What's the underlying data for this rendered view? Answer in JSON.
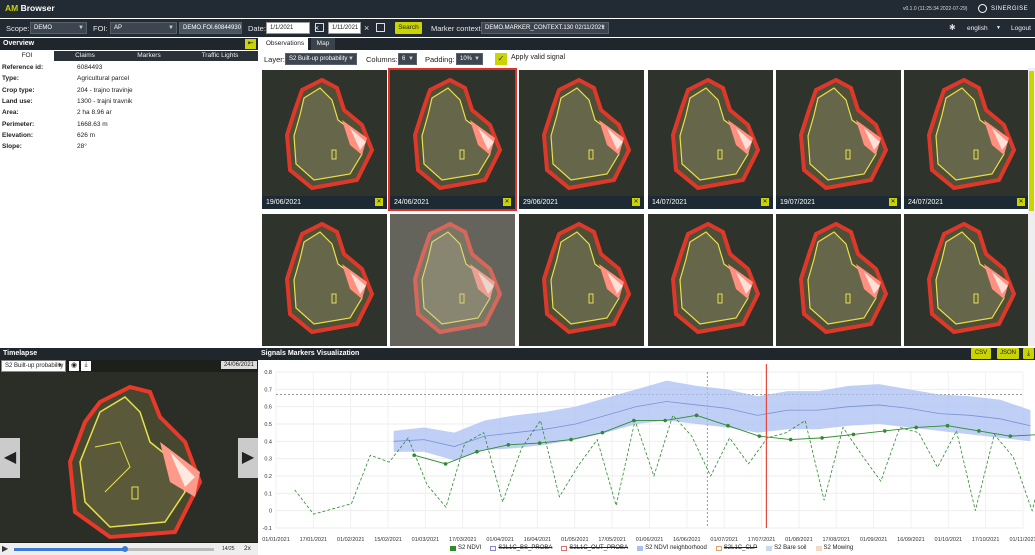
{
  "app": {
    "logo_am": "AM",
    "logo_rest": "Browser",
    "version": "v0.1.0 (11:25:34 2022-07-29)",
    "brand": "SINERGISE",
    "language": "english",
    "logout": "Logout"
  },
  "controls": {
    "scope_label": "Scope:",
    "scope_value": "DEMO",
    "foi_label": "FOI:",
    "foi_value": "AP",
    "foi_id": "DEMO.FOI.608449300",
    "date_label": "Date:",
    "date_from": "1/1/2021",
    "date_to": "1/11/2021",
    "search": "Search",
    "marker_label": "Marker context:",
    "marker_value": "DEMO.MARKER_CONTEXT.130 02/11/2021"
  },
  "overview": {
    "title": "Overview",
    "tabs": [
      "FOI",
      "Claims",
      "Markers",
      "Traffic Lights"
    ],
    "fields": [
      {
        "k": "Reference id:",
        "v": "6084493"
      },
      {
        "k": "Type:",
        "v": "Agricultural parcel"
      },
      {
        "k": "Crop type:",
        "v": "204 - trajno travinje"
      },
      {
        "k": "Land use:",
        "v": "1300 - trajni travnik"
      },
      {
        "k": "Area:",
        "v": "2 ha 8.96 ar"
      },
      {
        "k": "Perimeter:",
        "v": "1668.63 m"
      },
      {
        "k": "Elevation:",
        "v": "626 m"
      },
      {
        "k": "Slope:",
        "v": "28°"
      }
    ]
  },
  "observations": {
    "tabs": [
      "Observations",
      "Map"
    ],
    "layer_label": "Layer:",
    "layer_value": "S2 Built-up probability",
    "columns_label": "Columns:",
    "columns_value": "6",
    "padding_label": "Padding:",
    "padding_value": "10%",
    "valid_label": "Apply valid signal",
    "thumbs": [
      "19/06/2021",
      "24/06/2021",
      "29/06/2021",
      "14/07/2021",
      "19/07/2021",
      "24/07/2021",
      "",
      "",
      "",
      "",
      "",
      ""
    ]
  },
  "timelapse": {
    "title": "Timelapse",
    "layer": "S2 Built-up probability",
    "date": "24/06/2021",
    "frame": "14/25",
    "speed": "2x"
  },
  "signals": {
    "title": "Signals Markers Visualization",
    "csv": "CSV",
    "json": "JSON"
  },
  "chart_data": {
    "type": "line",
    "ylim": [
      -0.1,
      0.8
    ],
    "yticks": [
      "0.8",
      "0.7",
      "0.6",
      "0.5",
      "0.4",
      "0.3",
      "0.2",
      "0.1",
      "0",
      "-0.1"
    ],
    "xticks": [
      "01/01/2021",
      "17/01/2021",
      "01/02/2021",
      "15/02/2021",
      "01/03/2021",
      "17/03/2021",
      "01/04/2021",
      "16/04/2021",
      "01/05/2021",
      "17/05/2021",
      "01/06/2021",
      "16/06/2021",
      "01/07/2021",
      "17/07/2021",
      "01/08/2021",
      "17/08/2021",
      "01/09/2021",
      "16/09/2021",
      "01/10/2021",
      "17/10/2021",
      "01/11/2021"
    ],
    "ndvi_dashed": [
      0.12,
      -0.02,
      0.01,
      0.04,
      0.32,
      0.28,
      0.42,
      0.15,
      0.02,
      0.39,
      0.45,
      0.05,
      0.36,
      0.52,
      0.08,
      0.26,
      0.41,
      0.03,
      0.52,
      0.2,
      0.55,
      0.43,
      0.2,
      0.42,
      0.27,
      0.42,
      0.45,
      0.52,
      0.06,
      0.48,
      0.32,
      0.17,
      0.48,
      0.45,
      0.25,
      0.46,
      0.0,
      0.44,
      0.31,
      0.0,
      0.42
    ],
    "ndvi_points": [
      0.32,
      0.27,
      0.34,
      0.38,
      0.39,
      0.41,
      0.45,
      0.52,
      0.52,
      0.55,
      0.49,
      0.43,
      0.41,
      0.42,
      0.44,
      0.46,
      0.48,
      0.49,
      0.46,
      0.43,
      0.44
    ],
    "neighborhood_mean": [
      0.4,
      0.41,
      0.37,
      0.43,
      0.45,
      0.47,
      0.5,
      0.55,
      0.6,
      0.63,
      0.61,
      0.59,
      0.55,
      0.58,
      0.58,
      0.6,
      0.61,
      0.59,
      0.56,
      0.55,
      0.53,
      0.49
    ],
    "neighborhood_upper": [
      0.46,
      0.48,
      0.45,
      0.52,
      0.55,
      0.57,
      0.6,
      0.65,
      0.7,
      0.75,
      0.72,
      0.7,
      0.66,
      0.69,
      0.69,
      0.72,
      0.73,
      0.7,
      0.67,
      0.66,
      0.64,
      0.58
    ],
    "neighborhood_lower": [
      0.34,
      0.34,
      0.29,
      0.35,
      0.36,
      0.38,
      0.41,
      0.45,
      0.5,
      0.52,
      0.5,
      0.48,
      0.45,
      0.47,
      0.47,
      0.49,
      0.5,
      0.48,
      0.46,
      0.44,
      0.42,
      0.4
    ],
    "vline_date": "24/06/2021",
    "legend": [
      "S2 NDVI",
      "S2L1C_BS_PROBA",
      "S2L1C_OUT_PROBA",
      "S2 NDVI neighborhood",
      "S2L1C_CLP",
      "S2 Bare soil",
      "S2 Mowing"
    ],
    "colors": {
      "ndvi": "#2e8b2e",
      "neigh": "#aabff2",
      "neigh_line": "#7a92d8",
      "vline": "#e8493c"
    }
  }
}
